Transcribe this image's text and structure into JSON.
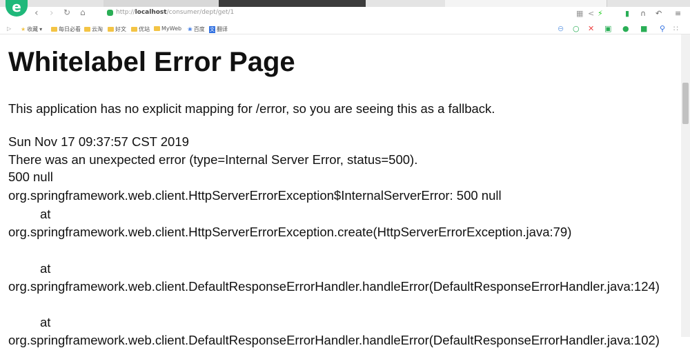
{
  "browser": {
    "url_prefix": "http://",
    "url_host": "localhost",
    "url_path": "/consumer/dept/get/1",
    "bookmarks": [
      "收藏",
      "每日必看",
      "云淘",
      "好文",
      "优站",
      "MyWeb",
      "百度",
      "翻译"
    ]
  },
  "page": {
    "title": "Whitelabel Error Page",
    "lines": [
      "This application has no explicit mapping for /error, so you are seeing this as a fallback.",
      "Sun Nov 17 09:37:57 CST 2019",
      "There was an unexpected error (type=Internal Server Error, status=500).",
      "500 null",
      "org.springframework.web.client.HttpServerErrorException$InternalServerError: 500 null",
      "at",
      "org.springframework.web.client.HttpServerErrorException.create(HttpServerErrorException.java:79)",
      "at",
      "org.springframework.web.client.DefaultResponseErrorHandler.handleError(DefaultResponseErrorHandler.java:124)",
      "at",
      "org.springframework.web.client.DefaultResponseErrorHandler.handleError(DefaultResponseErrorHandler.java:102)"
    ]
  }
}
